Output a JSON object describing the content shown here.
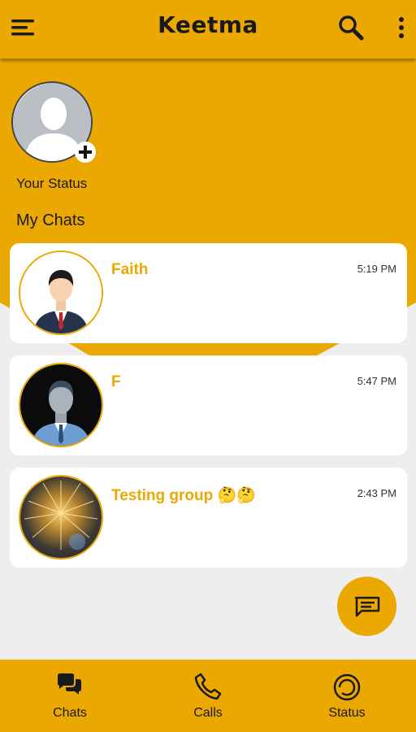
{
  "app": {
    "title": "Keetma"
  },
  "header": {
    "menu_icon": "hamburger-menu-icon",
    "search_icon": "search-icon",
    "more_icon": "more-vertical-icon"
  },
  "status": {
    "label": "Your Status",
    "add_icon": "plus-icon"
  },
  "chats": {
    "section_title": "My Chats",
    "items": [
      {
        "name": "Faith",
        "time": "5:19 PM",
        "avatar": "businessman-avatar"
      },
      {
        "name": "F",
        "time": "5:47 PM",
        "avatar": "man-avatar-dark"
      },
      {
        "name": "Testing group 🤔🤔",
        "time": "2:43 PM",
        "avatar": "fireworks-group-avatar"
      }
    ]
  },
  "fab": {
    "icon": "new-message-icon"
  },
  "bottom_nav": {
    "items": [
      {
        "label": "Chats",
        "icon": "chat-bubbles-icon"
      },
      {
        "label": "Calls",
        "icon": "phone-icon"
      },
      {
        "label": "Status",
        "icon": "status-ring-icon"
      }
    ]
  },
  "colors": {
    "accent": "#eaa800",
    "background": "#eeeeee",
    "card": "#ffffff"
  }
}
